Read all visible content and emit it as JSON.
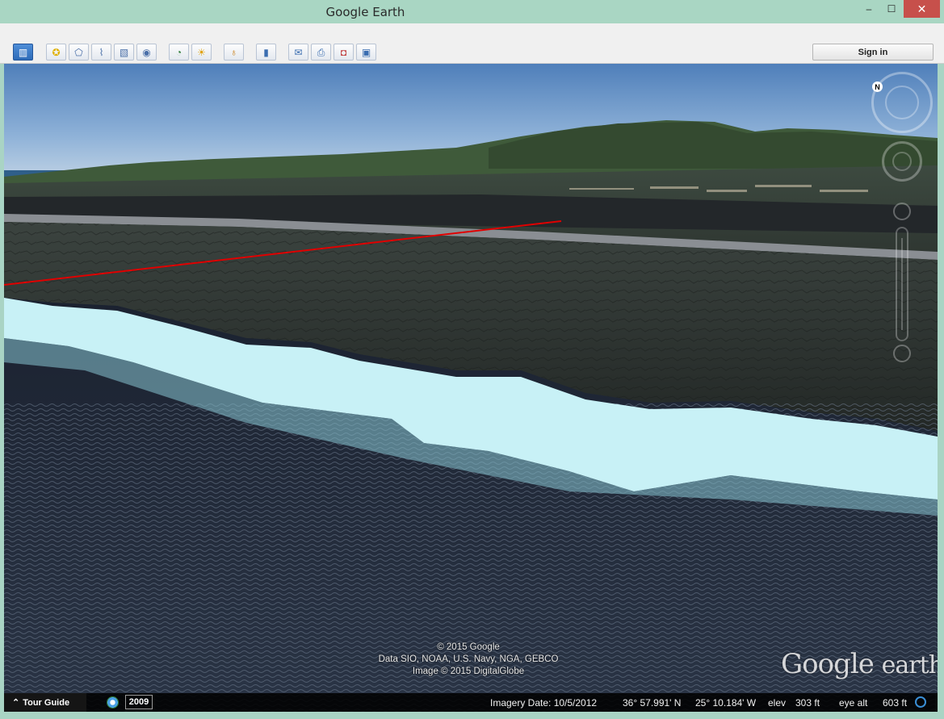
{
  "window": {
    "title": "Google Earth",
    "minimize": "‒",
    "maximize": "☐",
    "close": "✕"
  },
  "toolbar": {
    "buttons": [
      {
        "name": "sidebar-toggle-button",
        "icon": "sidebar-icon",
        "glyph": "▥",
        "active": true
      },
      {
        "name": "add-placemark-button",
        "icon": "placemark-icon",
        "glyph": "✪"
      },
      {
        "name": "add-polygon-button",
        "icon": "polygon-icon",
        "glyph": "⬠"
      },
      {
        "name": "add-path-button",
        "icon": "path-icon",
        "glyph": "⌇"
      },
      {
        "name": "add-image-overlay-button",
        "icon": "image-overlay-icon",
        "glyph": "▧"
      },
      {
        "name": "record-tour-button",
        "icon": "record-tour-icon",
        "glyph": "◉"
      },
      {
        "name": "historical-imagery-button",
        "icon": "clock-icon",
        "glyph": "◔"
      },
      {
        "name": "sunlight-button",
        "icon": "sun-icon",
        "glyph": "☀"
      },
      {
        "name": "switch-planet-button",
        "icon": "planet-icon",
        "glyph": "♁"
      },
      {
        "name": "ruler-button",
        "icon": "ruler-icon",
        "glyph": "▮"
      },
      {
        "name": "email-button",
        "icon": "email-icon",
        "glyph": "✉"
      },
      {
        "name": "print-button",
        "icon": "print-icon",
        "glyph": "⎙"
      },
      {
        "name": "view-in-maps-button",
        "icon": "maps-icon",
        "glyph": "◘"
      },
      {
        "name": "save-image-button",
        "icon": "save-image-icon",
        "glyph": "▣"
      }
    ],
    "sign_in": "Sign in"
  },
  "map": {
    "copyright_lines": [
      "© 2015 Google",
      "Data SIO, NOAA, U.S. Navy, NGA, GEBCO",
      "Image © 2015 DigitalGlobe"
    ],
    "logo_google": "Google",
    "logo_earth": "earth",
    "compass_north": "N",
    "path_color": "#e00000"
  },
  "status": {
    "tour_guide": "Tour Guide",
    "tour_guide_icon": "chevron-up-icon",
    "year": "2009",
    "imagery_date": "Imagery Date: 10/5/2012",
    "latitude": "36° 57.991' N",
    "longitude": "25° 10.184' W",
    "elev_label": "elev",
    "elev_value": "303 ft",
    "eye_alt_label": "eye alt",
    "eye_alt_value": "603 ft"
  }
}
